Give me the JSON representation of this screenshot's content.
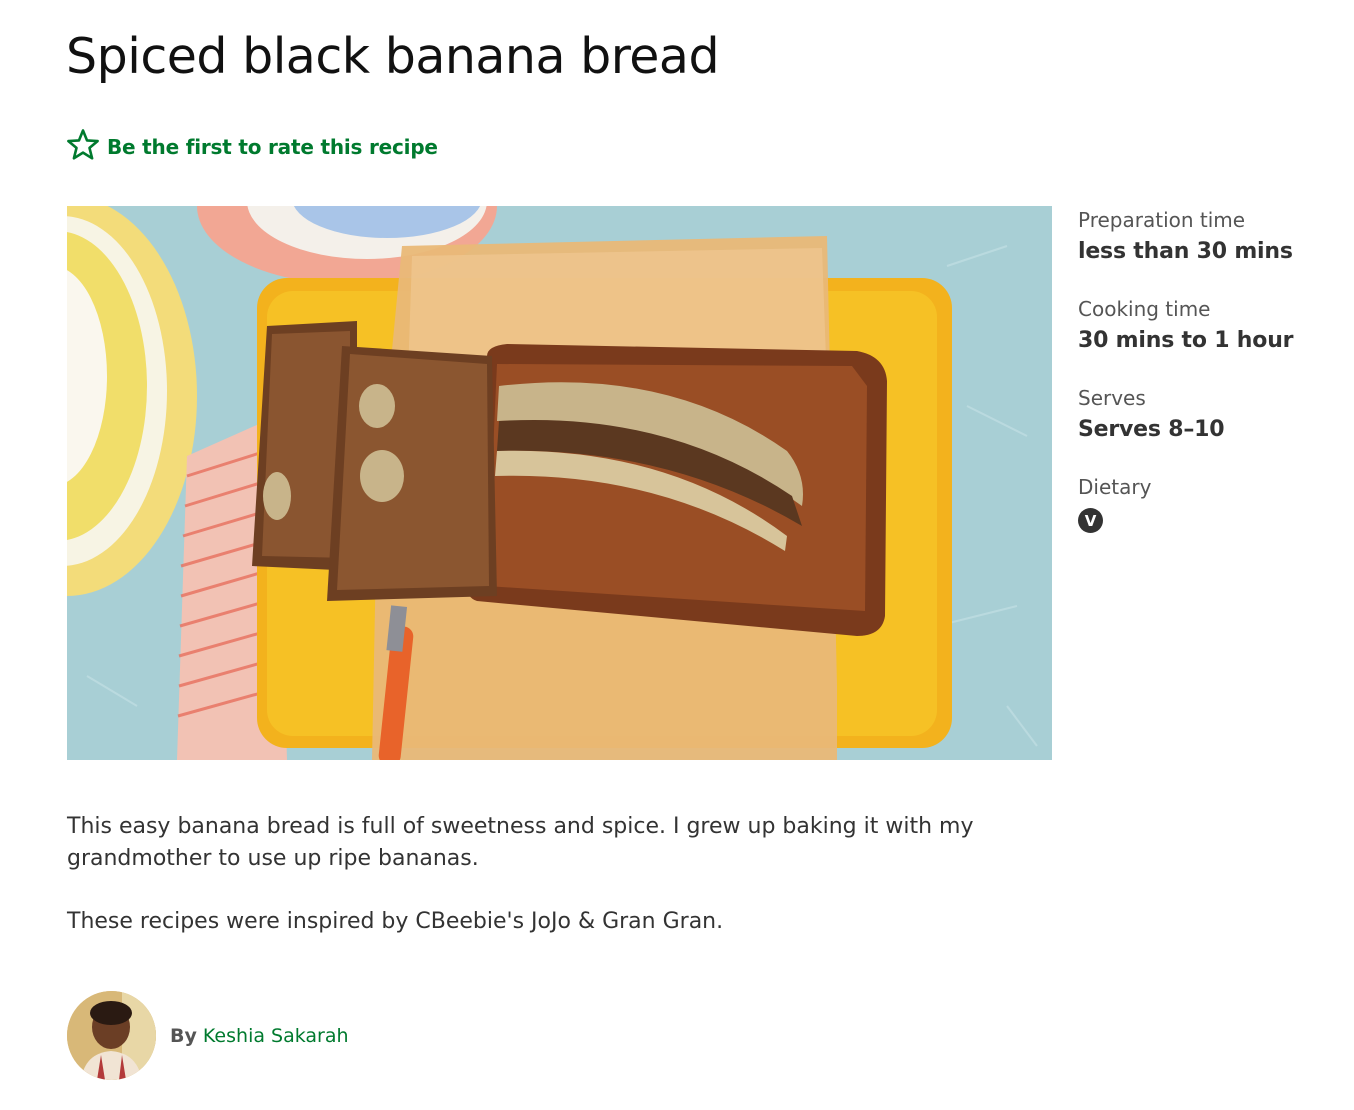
{
  "recipe": {
    "title": "Spiced black banana bread",
    "rating_cta": "Be the first to rate this recipe"
  },
  "image": {
    "alt": "Spiced black banana bread"
  },
  "facts": {
    "prep_label": "Preparation time",
    "prep_value": "less than 30 mins",
    "cook_label": "Cooking time",
    "cook_value": "30 mins to 1 hour",
    "serves_label": "Serves",
    "serves_value": "Serves 8–10",
    "dietary_label": "Dietary",
    "dietary_badge": "V"
  },
  "description": {
    "paragraph_1": "This easy banana bread is full of sweetness and spice. I grew up baking it with my grandmother to use up ripe bananas.",
    "paragraph_2": "These recipes were inspired by CBeebie's JoJo & Gran Gran."
  },
  "author": {
    "by_label": "By",
    "name": "Keshia Sakarah"
  },
  "icons": {
    "rating": "star-outline-icon",
    "vegetarian": "vegetarian-badge-icon"
  },
  "colors": {
    "accent_green": "#007a2e",
    "text_dark": "#333333",
    "badge_bg": "#333333"
  }
}
